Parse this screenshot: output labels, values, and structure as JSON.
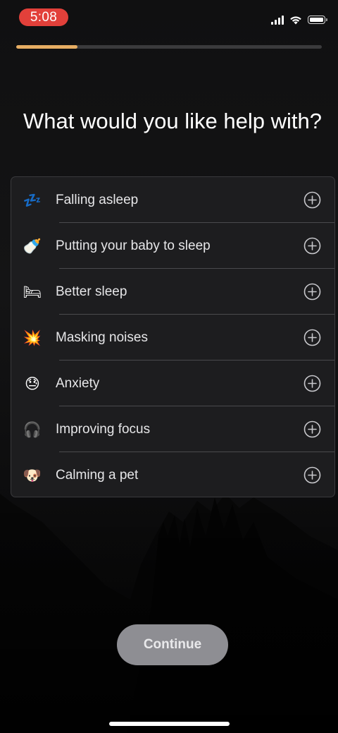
{
  "status_bar": {
    "time": "5:08"
  },
  "onboarding": {
    "progress_fraction": 0.2,
    "accent_color": "#e6ad63"
  },
  "title": "What would you like help with?",
  "options": [
    {
      "emoji": "💤",
      "icon": "zzz-icon",
      "label": "Falling asleep"
    },
    {
      "emoji": "🍼",
      "icon": "baby-bottle-icon",
      "label": "Putting your baby to sleep"
    },
    {
      "emoji": "🛏",
      "icon": "bed-icon",
      "label": "Better sleep"
    },
    {
      "emoji": "💥",
      "icon": "collision-icon",
      "label": "Masking noises"
    },
    {
      "emoji": "😓",
      "icon": "sweat-face-icon",
      "label": "Anxiety"
    },
    {
      "emoji": "🎧",
      "icon": "headphones-icon",
      "label": "Improving focus"
    },
    {
      "emoji": "🐶",
      "icon": "dog-face-icon",
      "label": "Calming a pet"
    }
  ],
  "continue_button": {
    "label": "Continue"
  }
}
